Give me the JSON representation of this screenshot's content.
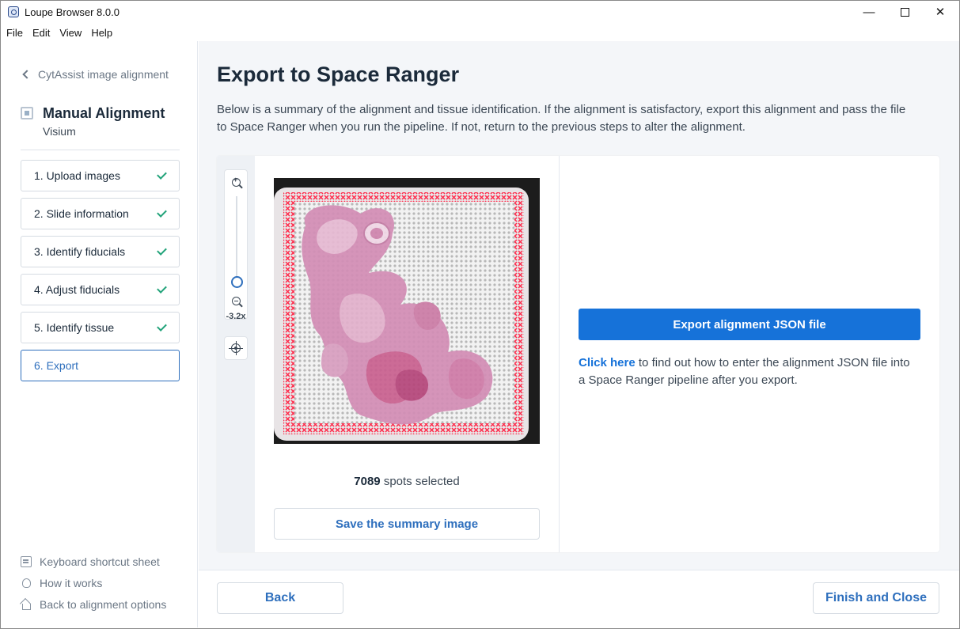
{
  "window": {
    "title": "Loupe Browser 8.0.0",
    "minimize": "—",
    "close": "✕"
  },
  "menu": [
    "File",
    "Edit",
    "View",
    "Help"
  ],
  "sidebar": {
    "back_label": "CytAssist image alignment",
    "mode_title": "Manual Alignment",
    "mode_subtitle": "Visium",
    "steps": [
      {
        "label": "1. Upload images",
        "complete": true
      },
      {
        "label": "2. Slide information",
        "complete": true
      },
      {
        "label": "3. Identify fiducials",
        "complete": true
      },
      {
        "label": "4. Adjust fiducials",
        "complete": true
      },
      {
        "label": "5. Identify tissue",
        "complete": true
      },
      {
        "label": "6. Export",
        "complete": false,
        "active": true
      }
    ],
    "bottom_links": {
      "keyboard": "Keyboard shortcut sheet",
      "how": "How it works",
      "back_options": "Back to alignment options"
    }
  },
  "main": {
    "title": "Export to Space Ranger",
    "description": "Below is a summary of the alignment and tissue identification. If the alignment is satisfactory, export this alignment and pass the file to Space Ranger when you run the pipeline. If not, return to the previous steps to alter the alignment.",
    "zoom_level": "-3.2x",
    "spots_count": "7089",
    "spots_suffix": "spots selected",
    "save_button": "Save the summary image",
    "export_button": "Export alignment JSON file",
    "help_link": "Click here",
    "help_text": " to find out how to enter the alignment JSON file into a Space Ranger pipeline after you export."
  },
  "footer": {
    "back_button": "Back",
    "finish_button": "Finish and Close"
  },
  "colors": {
    "accent": "#1672d9",
    "check": "#22a37a",
    "fiducial": "#ff2a4a",
    "tissue": "#c8639a"
  }
}
